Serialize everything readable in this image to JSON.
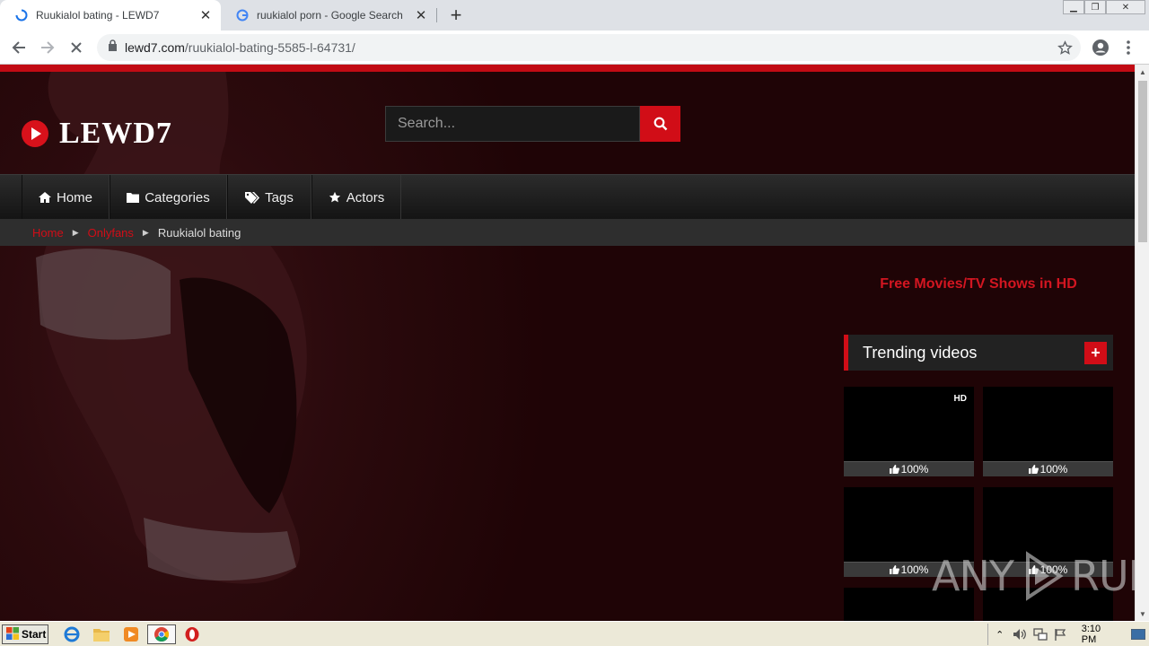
{
  "browser": {
    "tabs": [
      {
        "title": "Ruukialol bating - LEWD7",
        "active": true
      },
      {
        "title": "ruukialol porn - Google Search",
        "active": false
      }
    ],
    "url_domain": "lewd7.com",
    "url_path": "/ruukialol-bating-5585-l-64731/"
  },
  "site": {
    "logo": "LEWD7",
    "search_placeholder": "Search...",
    "nav": [
      {
        "label": "Home",
        "icon": "home-icon"
      },
      {
        "label": "Categories",
        "icon": "folder-icon"
      },
      {
        "label": "Tags",
        "icon": "tags-icon"
      },
      {
        "label": "Actors",
        "icon": "star-icon"
      }
    ],
    "breadcrumb": [
      {
        "label": "Home",
        "link": true
      },
      {
        "label": "Onlyfans",
        "link": true
      },
      {
        "label": "Ruukialol bating",
        "link": false
      }
    ],
    "promo_link": "Free Movies/TV Shows in HD",
    "sidebar": {
      "widget_title": "Trending videos",
      "videos": [
        {
          "badge": "HD",
          "rating": "100%"
        },
        {
          "badge": "",
          "rating": "100%"
        },
        {
          "badge": "",
          "rating": "100%"
        },
        {
          "badge": "",
          "rating": "100%"
        }
      ]
    },
    "accent_color": "#d10d17"
  },
  "watermark": {
    "left": "ANY",
    "right": "RUN"
  },
  "taskbar": {
    "start_label": "Start",
    "clock": "3:10 PM"
  }
}
